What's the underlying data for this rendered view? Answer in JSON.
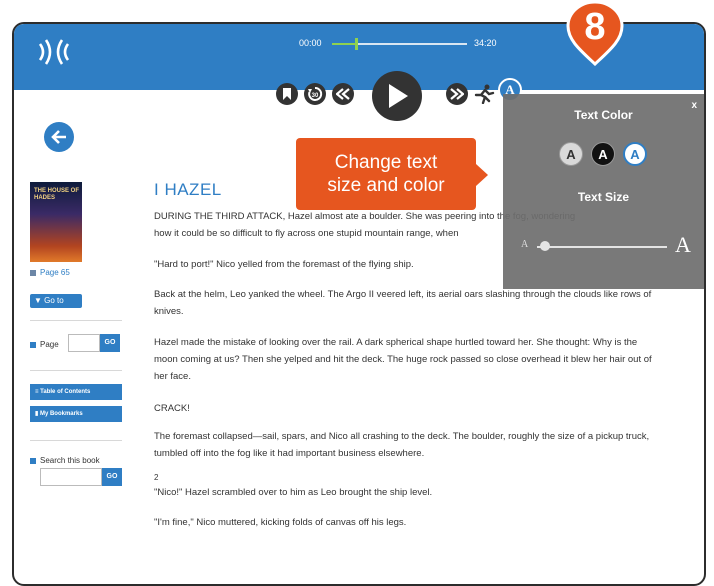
{
  "player": {
    "time_start": "00:00",
    "time_end": "34:20",
    "progress": 0.17,
    "font_toggle": "A",
    "icons": [
      "audio-logo-icon",
      "bookmark-icon",
      "replay-30-icon",
      "rewind-icon",
      "play-icon",
      "fast-forward-icon",
      "speed-runner-icon"
    ]
  },
  "sidebar": {
    "cover_text": "THE HOUSE OF HADES",
    "page_indicator": "Page 65",
    "goto_label": "▼ Go to",
    "page_label": "Page",
    "go_label": "GO",
    "toc_label": "Table of Contents",
    "bookmarks_label": "My Bookmarks",
    "search_label": "Search this book"
  },
  "book": {
    "chapter_title": "I HAZEL",
    "paragraphs": [
      {
        "text": "DURING THE THIRD ATTACK, Hazel almost ate a boulder. She was peering into the fog, wondering"
      },
      {
        "text": "how it could be so difficult to fly across one stupid mountain range, when"
      },
      {
        "text": "\"Hard to port!\" Nico yelled from the foremast of the flying ship."
      },
      {
        "text": "Back at the helm, Leo yanked the wheel. The Argo II veered left, its aerial oars slashing through the clouds like rows of knives."
      },
      {
        "text": "Hazel made the mistake of looking over the rail. A dark spherical shape hurtled toward her. She thought: Why is the moon coming at us? Then she yelped and hit the deck. The huge rock passed so close overhead it blew her hair out of her face."
      },
      {
        "text": "CRACK!"
      },
      {
        "text": "The foremast collapsed—sail, spars, and Nico all crashing to the deck. The boulder, roughly the size of a pickup truck, tumbled off into the fog like it had important business elsewhere."
      },
      {
        "text": "2"
      },
      {
        "text": "\"Nico!\" Hazel scrambled over to him as Leo brought the ship level."
      },
      {
        "text": "\"I'm fine,\" Nico muttered, kicking folds of canvas off his legs."
      }
    ]
  },
  "panel": {
    "close_label": "x",
    "text_color_title": "Text Color",
    "swatches": [
      {
        "label": "A",
        "bg": "#d9d9d9",
        "fg": "#333333"
      },
      {
        "label": "A",
        "bg": "#111111",
        "fg": "#ffffff"
      },
      {
        "label": "A",
        "bg": "#ffffff",
        "fg": "#2f7ec4",
        "selected": true
      }
    ],
    "text_size_title": "Text Size",
    "size_min_label": "A",
    "size_max_label": "A",
    "size_level": 0.05
  },
  "callout": {
    "line1": "Change text",
    "line2": "size and color"
  },
  "step_badge": "8",
  "colors": {
    "accent": "#2f7ec4",
    "callout": "#e6561f",
    "panel": "#6e6e6e"
  }
}
